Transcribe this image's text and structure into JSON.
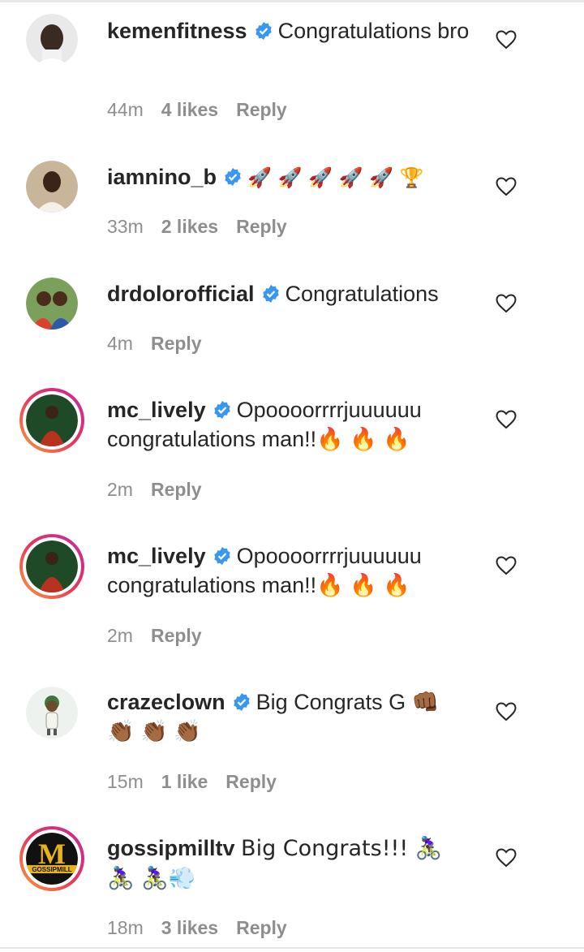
{
  "comments": [
    {
      "username": "kemenfitness",
      "text": "Congratulations bro",
      "time": "44m",
      "likes": "4 likes",
      "reply": "Reply",
      "verified": true
    },
    {
      "username": "iamnino_b",
      "text": "🚀 🚀 🚀 🚀 🚀 🏆",
      "time": "33m",
      "likes": "2 likes",
      "reply": "Reply",
      "verified": true
    },
    {
      "username": "drdolorofficial",
      "text": "Congratulations",
      "time": "4m",
      "likes": "",
      "reply": "Reply",
      "verified": true
    },
    {
      "username": "mc_lively",
      "text": "Opoooorrrrjuuuuuu congratulations man!!🔥 🔥 🔥",
      "time": "2m",
      "likes": "",
      "reply": "Reply",
      "verified": true
    },
    {
      "username": "mc_lively",
      "text": "Opoooorrrrjuuuuuu congratulations man!!🔥 🔥 🔥",
      "time": "2m",
      "likes": "",
      "reply": "Reply",
      "verified": true
    },
    {
      "username": "crazeclown",
      "text": "Big Congrats G 👊🏾 👏🏾 👏🏾 👏🏾",
      "time": "15m",
      "likes": "1 like",
      "reply": "Reply",
      "verified": true
    },
    {
      "username": "gossipmilltv",
      "text": "Big Congrats!!! 🚴🏿‍♀️ 🚴🏿‍♀️ 🚴🏿‍♀️💨",
      "time": "18m",
      "likes": "3 likes",
      "reply": "Reply",
      "verified": false
    }
  ],
  "colors": {
    "verified_blue": "#3897f0",
    "meta_gray": "#8e8e8e",
    "text": "#262626"
  },
  "avatars": {
    "gossipmill_letter": "M",
    "gossipmill_banner": "GOSSIPMILL"
  }
}
